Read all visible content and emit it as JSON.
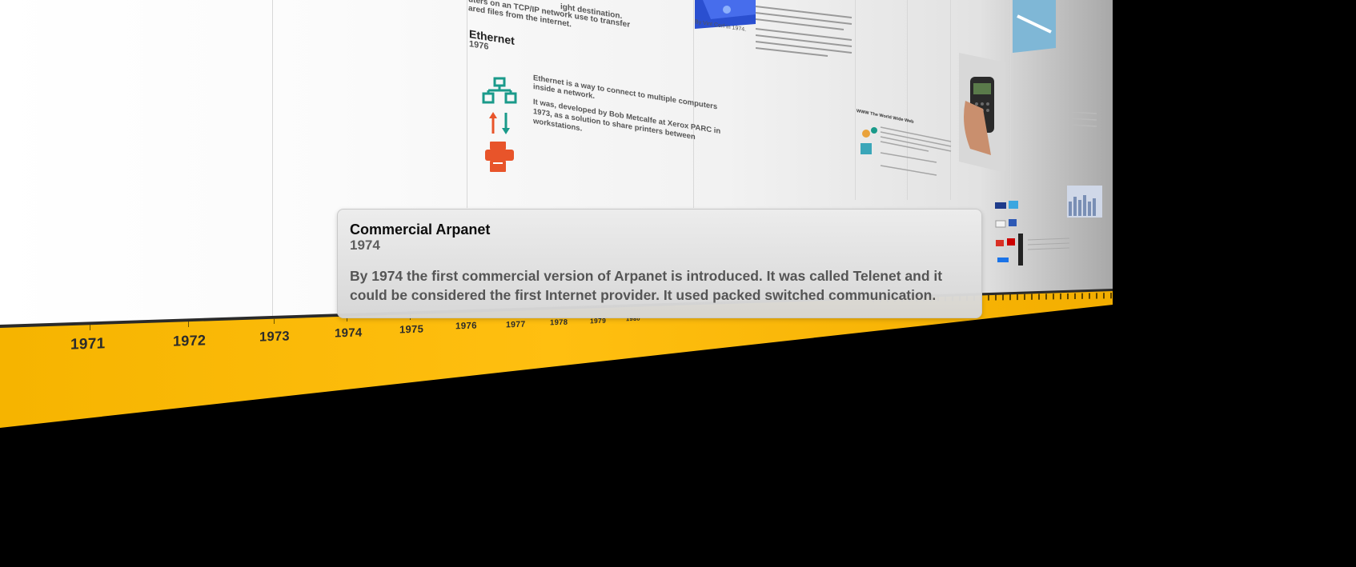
{
  "timeline": {
    "years": [
      "1971",
      "1972",
      "1973",
      "1974",
      "1975",
      "1976",
      "1977",
      "1978",
      "1979",
      "1980"
    ]
  },
  "cards": {
    "tcpip_fragment": {
      "line1": "ight destination.",
      "line2": "uters on an TCP/IP network use to transfer",
      "line3": "ared files from the internet."
    },
    "ethernet": {
      "title": "Ethernet",
      "year": "1976",
      "text1": "Ethernet is a way to connect to multiple computers inside a network.",
      "text2": "It was, developed by Bob Metcalfe at Xerox PARC in 1973, as a solution to share printers between workstations."
    },
    "cerf": {
      "caption": "By Vint Cerf in 1974."
    },
    "www": {
      "title": "WWW The World Wide Web"
    }
  },
  "popup": {
    "title": "Commercial Arpanet",
    "year": "1974",
    "body": "By 1974 the first commercial version of Arpanet is introduced. It was called Telenet and it could be considered the first Internet provider. It used packed switched communication."
  },
  "colors": {
    "timeline_band": "#ffbf10",
    "popup_bg": "#e2e2e2",
    "network_icon": "#1a9a8a",
    "printer_icon": "#e8542a"
  }
}
